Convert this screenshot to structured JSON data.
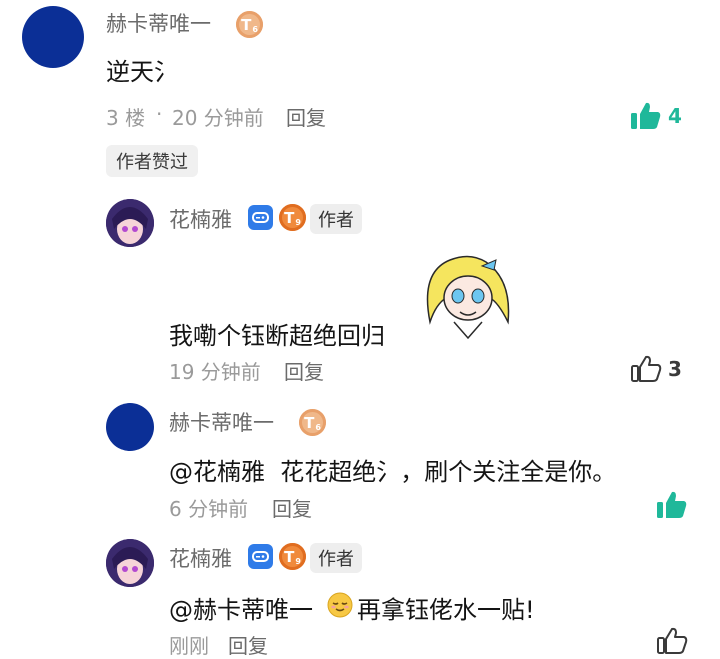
{
  "comment": {
    "user": "赫卡蒂唯一",
    "level_badge": "T",
    "level_sub": "6",
    "text": "逆天氵",
    "floor": "3 楼",
    "dot": "·",
    "time": "20 分钟前",
    "reply": "回复",
    "likes": "4",
    "author_liked_tag": "作者赞过"
  },
  "replies": [
    {
      "user": "花楠雅",
      "level_badge": "T",
      "level_sub": "9",
      "author_tag": "作者",
      "text": "我嘞个钰断超绝回归",
      "time": "19 分钟前",
      "reply": "回复",
      "likes": "3"
    },
    {
      "user": "赫卡蒂唯一",
      "level_badge": "T",
      "level_sub": "6",
      "mention": "@花楠雅",
      "text": "花花超绝氵，刷个关注全是你。",
      "time": "6 分钟前",
      "reply": "回复"
    },
    {
      "user": "花楠雅",
      "level_badge": "T",
      "level_sub": "9",
      "author_tag": "作者",
      "mention": "@赫卡蒂唯一",
      "text": "再拿钰佬水一贴!",
      "time": "刚刚",
      "reply": "回复"
    }
  ],
  "colors": {
    "accent_like": "#1fb89a",
    "avatar_blue": "#0b2f96",
    "coin": "#f0b88a"
  }
}
